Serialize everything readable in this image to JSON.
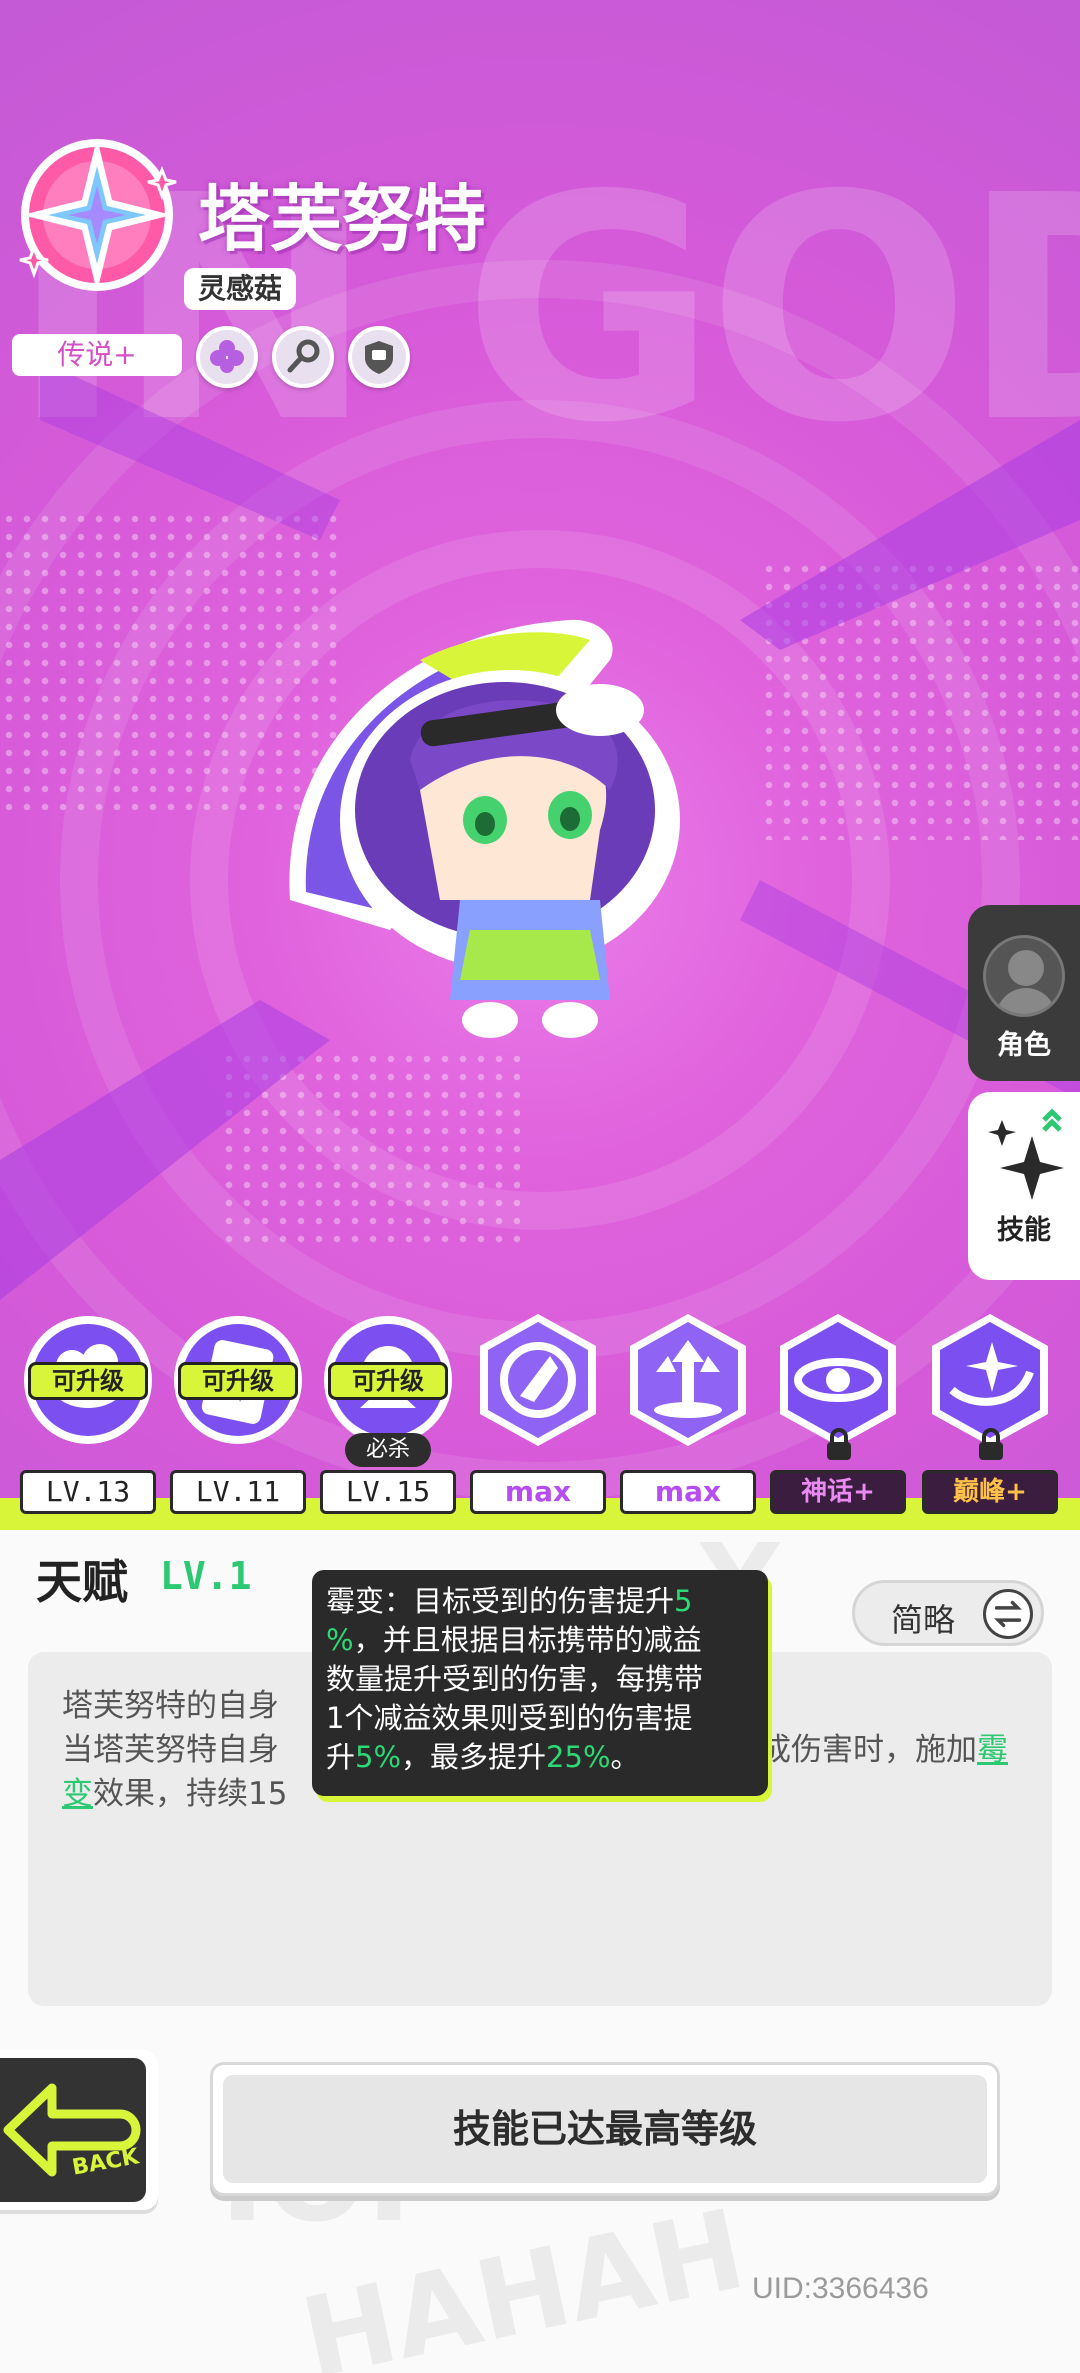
{
  "character": {
    "name": "塔芙努特",
    "subtitle": "灵感菇",
    "rarity": "传说+",
    "traits": [
      "clover-icon",
      "key-icon",
      "shield-icon"
    ]
  },
  "side_tabs": [
    {
      "label": "角色",
      "icon": "avatar-icon",
      "active": false
    },
    {
      "label": "技能",
      "icon": "sparkle-star-icon",
      "active": true
    }
  ],
  "skills": [
    {
      "badge": "可升级",
      "level": "LV.13"
    },
    {
      "badge": "可升级",
      "level": "LV.11"
    },
    {
      "badge": "可升级",
      "level": "LV.15",
      "tag": "必杀"
    },
    {
      "level": "max"
    },
    {
      "level": "max"
    },
    {
      "level": "神话+",
      "locked": true
    },
    {
      "level": "巅峰+",
      "locked": true
    }
  ],
  "talent": {
    "title": "天赋",
    "level": "LV.1",
    "toggle_label": "简略",
    "description_line1": "塔芙努特的自身",
    "description_line2_a": "当塔芙努特自身",
    "description_line2_b": "成伤害时，施加",
    "description_line2_hl": "霉",
    "description_line3_hl": "变",
    "description_line3_b": "效果，持续15"
  },
  "tooltip": {
    "l1_a": "霉变：目标受到的伤害提升",
    "l1_g": "5",
    "l2_g": "%",
    "l2_a": "，并且根据目标携带的减益",
    "l3": "数量提升受到的伤害，每携带",
    "l4": "1个减益效果则受到的伤害提",
    "l5_a": "升",
    "l5_g1": "5%",
    "l5_b": "，最多提升",
    "l5_g2": "25%",
    "l5_c": "。"
  },
  "buttons": {
    "back_label": "BACK",
    "max_label": "技能已达最高等级"
  },
  "uid": "UID:3366436",
  "colors": {
    "hero_bg": "#d65ad9",
    "accent_green": "#2cc872",
    "badge_yellow": "#d9f53a",
    "skill_purple": "#7b4ff0"
  }
}
